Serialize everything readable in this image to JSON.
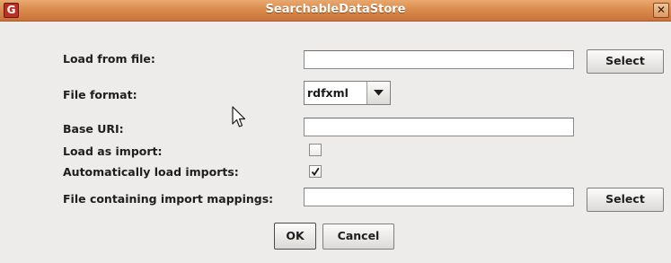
{
  "window": {
    "title": "SearchableDataStore",
    "icon_letter": "G",
    "close_glyph": "✕"
  },
  "form": {
    "load_from_file": {
      "label": "Load from file:",
      "value": "",
      "button": "Select"
    },
    "file_format": {
      "label": "File format:",
      "selected": "rdfxml"
    },
    "base_uri": {
      "label": "Base URI:",
      "value": ""
    },
    "load_as_import": {
      "label": "Load as import:",
      "checked": false
    },
    "auto_load_imports": {
      "label": "Automatically load imports:",
      "checked": true
    },
    "import_mappings": {
      "label": "File containing import mappings:",
      "value": "",
      "button": "Select"
    }
  },
  "actions": {
    "ok": "OK",
    "cancel": "Cancel"
  },
  "icons": {
    "app": "g-app-icon",
    "close": "close-icon",
    "dropdown": "chevron-down-icon",
    "check": "checkmark-icon",
    "cursor": "mouse-pointer-icon"
  },
  "colors": {
    "titlebar": "#d98a4b",
    "background": "#edeceb",
    "app_icon": "#c12d1f"
  }
}
